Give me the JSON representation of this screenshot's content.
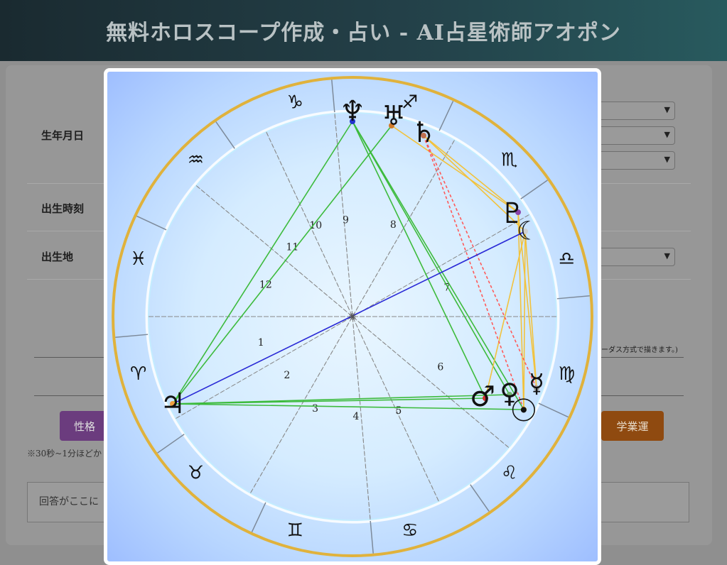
{
  "header": {
    "title": "無料ホロスコープ作成・占い - AI占星術師アオポン"
  },
  "form": {
    "birth_date_label": "生年月日",
    "birth_time_label": "出生時刻",
    "birth_place_label": "出生地",
    "method_note": "ーダス方式で描きます。)",
    "personality_button": "性格",
    "study_button": "学業運",
    "wait_note": "※30秒~1分ほどか",
    "answer_placeholder": "回答がここに"
  },
  "chart": {
    "zodiac_signs": [
      "♑",
      "♒",
      "♓",
      "♈",
      "♉",
      "♊",
      "♋",
      "♌",
      "♍",
      "♎",
      "♏",
      "♐"
    ],
    "houses": [
      "1",
      "2",
      "3",
      "4",
      "5",
      "6",
      "7",
      "8",
      "9",
      "10",
      "11",
      "12"
    ],
    "planets": {
      "neptune": "♆",
      "uranus": "♅",
      "saturn": "♄",
      "pluto": "♇",
      "moon": "☾",
      "jupiter": "♃",
      "mars": "♂",
      "venus": "♀",
      "mercury": "☿",
      "sun": "☉"
    },
    "colors": {
      "outer_ring": "#e0b23c",
      "trine_line": "#3dbb3d",
      "sextile_line": "#f2c23c",
      "square_line": "#ff5a5a",
      "opposition_line": "#2a2ad6"
    }
  }
}
